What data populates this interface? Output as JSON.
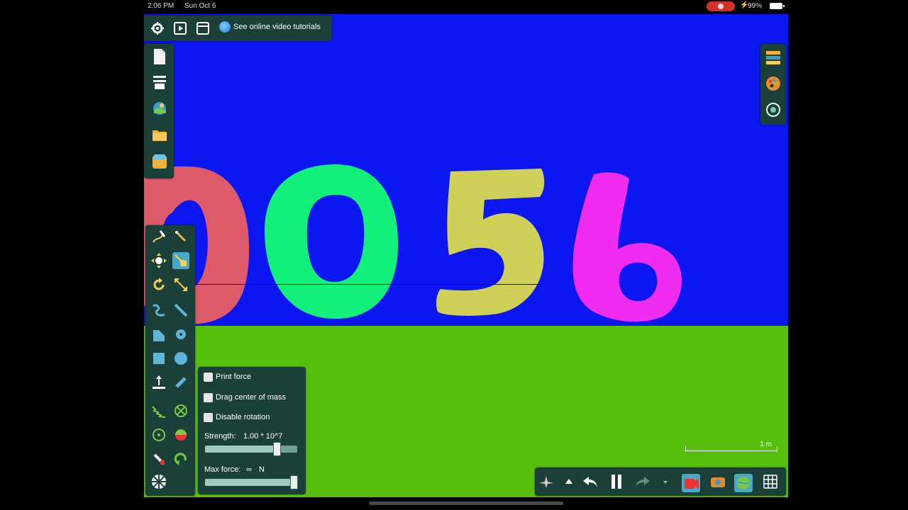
{
  "status_bar": {
    "time": "2:06 PM",
    "date": "Sun Oct 6",
    "battery": "99%"
  },
  "top_bar": {
    "tutorial_label": "See online video tutorials",
    "icons": [
      "gear-icon",
      "play-icon",
      "window-icon",
      "globe-icon"
    ]
  },
  "left_bar": {
    "icons": [
      "new-scene-icon",
      "menu-icon",
      "scene-image-icon",
      "folder-icon",
      "save-icon"
    ]
  },
  "right_bar": {
    "icons": [
      "layers-icon",
      "palette-icon",
      "camera-follow-icon"
    ]
  },
  "toolbox": {
    "tools": [
      "sketch-tool",
      "brush-tool",
      "move-tool",
      "drag-tool",
      "rotate-tool",
      "scale-tool",
      "chain-tool",
      "knife-tool",
      "plane-tool",
      "gear-tool",
      "box-tool",
      "circle-tool",
      "thruster-tool",
      "pen-tool",
      "spring-tool",
      "fixate-tool",
      "axle-tool",
      "tracer-tool",
      "eraser-tool",
      "hinge-tool",
      "texture-tool"
    ],
    "selected": "drag-tool"
  },
  "drag_properties": {
    "print_force": "Print force",
    "drag_center_of_mass": "Drag center of mass",
    "disable_rotation": "Disable rotation",
    "strength_label": "Strength:",
    "strength_value": "1.00 * 10^7",
    "strength_fraction": 0.8,
    "max_force_label": "Max force:",
    "max_force_value": "∞",
    "max_force_unit": "N",
    "max_force_fraction": 1.0
  },
  "scale": {
    "label": "1 m"
  },
  "scene": {
    "digits": [
      "0",
      "0",
      "5",
      "6"
    ],
    "colors": {
      "sky": "#0b16f0",
      "ground": "#56c00c",
      "digit1": "#dc5a6a",
      "digit2": "#12f07a",
      "digit3": "#cfd057",
      "digit4": "#f02cf0"
    }
  },
  "bottom_bar": {
    "buttons": [
      "airplane-icon",
      "up-arrow-icon",
      "undo-icon",
      "pause-icon",
      "redo-icon",
      "down-arrow-icon",
      "record-icon",
      "camera-icon",
      "planet-icon",
      "grid-icon"
    ]
  }
}
